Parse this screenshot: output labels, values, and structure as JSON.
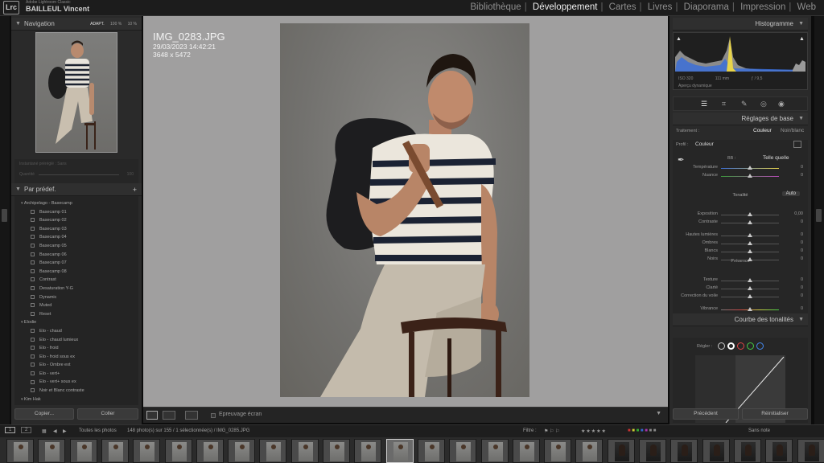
{
  "app": {
    "logo": "Lrc",
    "owner_caption": "Adobe Lightroom Classic",
    "owner_name": "BAILLEUL Vincent"
  },
  "modules": [
    "Bibliothèque",
    "Développement",
    "Cartes",
    "Livres",
    "Diaporama",
    "Impression",
    "Web"
  ],
  "active_module": "Développement",
  "navigator": {
    "title": "Navigation",
    "zoom_options": [
      "ADAPT.",
      "100 %",
      "10 %"
    ]
  },
  "snapshot": {
    "label": "Instantané préréglé : Sans",
    "quantity_label": "Quantité",
    "quantity_value": "100"
  },
  "presets": {
    "title": "Par prédef.",
    "add_symbol": "+",
    "items": [
      {
        "type": "folder",
        "label": "Archipelago - Basecamp"
      },
      {
        "type": "item",
        "label": "Basecamp 01"
      },
      {
        "type": "item",
        "label": "Basecamp 02"
      },
      {
        "type": "item",
        "label": "Basecamp 03"
      },
      {
        "type": "item",
        "label": "Basecamp 04"
      },
      {
        "type": "item",
        "label": "Basecamp 05"
      },
      {
        "type": "item",
        "label": "Basecamp 06"
      },
      {
        "type": "item",
        "label": "Basecamp 07"
      },
      {
        "type": "item",
        "label": "Basecamp 08"
      },
      {
        "type": "item",
        "label": "Contrast"
      },
      {
        "type": "item",
        "label": "Desaturation Y-G"
      },
      {
        "type": "item",
        "label": "Dynamic"
      },
      {
        "type": "item",
        "label": "Muted"
      },
      {
        "type": "item",
        "label": "Reset"
      },
      {
        "type": "folder",
        "label": "Elodie"
      },
      {
        "type": "item",
        "label": "Elo - chaud"
      },
      {
        "type": "item",
        "label": "Elo - chaud lumieux"
      },
      {
        "type": "item",
        "label": "Elo - froid"
      },
      {
        "type": "item",
        "label": "Elo - froid sous ex"
      },
      {
        "type": "item",
        "label": "Elo - Ombre ext"
      },
      {
        "type": "item",
        "label": "Elo - vert+"
      },
      {
        "type": "item",
        "label": "Elo - vert+ sous ex"
      },
      {
        "type": "item",
        "label": "Noir et Blanc contraste"
      },
      {
        "type": "folder",
        "label": "Kim Hak"
      }
    ]
  },
  "left_buttons": {
    "copy": "Copier...",
    "paste": "Coller"
  },
  "photo_info": {
    "filename": "IMG_0283.JPG",
    "datetime": "29/03/2023 14:42:21",
    "dimensions": "3648 x 5472"
  },
  "toolbar": {
    "soft_proof": "Epreuvage écran"
  },
  "histogram": {
    "title": "Histogramme",
    "iso": "ISO 320",
    "focal": "111 mm",
    "aperture": "ƒ / 9,5",
    "preview_label": "Aperçu dynamique"
  },
  "basic": {
    "title": "Réglages de base",
    "treatment_label": "Traitement :",
    "treatment_color": "Couleur",
    "treatment_bw": "Noir/blanc",
    "profile_label": "Profil :",
    "profile_value": "Couleur",
    "wb_label": "BB :",
    "wb_value": "Telle quelle",
    "tone_label": "Tonalité",
    "auto_label": "Auto",
    "presence_label": "Présence",
    "sliders": [
      {
        "label": "Température",
        "value": "0",
        "pos": 0.5
      },
      {
        "label": "Nuance",
        "value": "0",
        "pos": 0.5
      },
      {
        "label": "Exposition",
        "value": "0,00",
        "pos": 0.5
      },
      {
        "label": "Contraste",
        "value": "0",
        "pos": 0.5
      },
      {
        "label": "Hautes lumières",
        "value": "0",
        "pos": 0.5
      },
      {
        "label": "Ombres",
        "value": "0",
        "pos": 0.5
      },
      {
        "label": "Blancs",
        "value": "0",
        "pos": 0.5
      },
      {
        "label": "Noirs",
        "value": "0",
        "pos": 0.5
      },
      {
        "label": "Texture",
        "value": "0",
        "pos": 0.5
      },
      {
        "label": "Clarté",
        "value": "0",
        "pos": 0.5
      },
      {
        "label": "Correction du voile",
        "value": "0",
        "pos": 0.5
      },
      {
        "label": "Vibrance",
        "value": "0",
        "pos": 0.5
      },
      {
        "label": "Saturation",
        "value": "0",
        "pos": 0.5
      }
    ]
  },
  "curve": {
    "title": "Courbe des tonalités",
    "region_label": "Régler :"
  },
  "right_buttons": {
    "previous": "Précédent",
    "reset": "Réinitialiser"
  },
  "filmstrip": {
    "pages": [
      "1",
      "2"
    ],
    "source": "Toutes les photos",
    "count": "148 photo(s) sur 155 / 1 sélectionnée(s) / IMG_0285.JPG",
    "filter_label": "Filtre :",
    "filter_value": "Sans note"
  },
  "colors": {
    "accent_yellow": "#e8d44a",
    "accent_blue": "#3b6fd8",
    "histogram_gray": "#8b8b8b"
  }
}
